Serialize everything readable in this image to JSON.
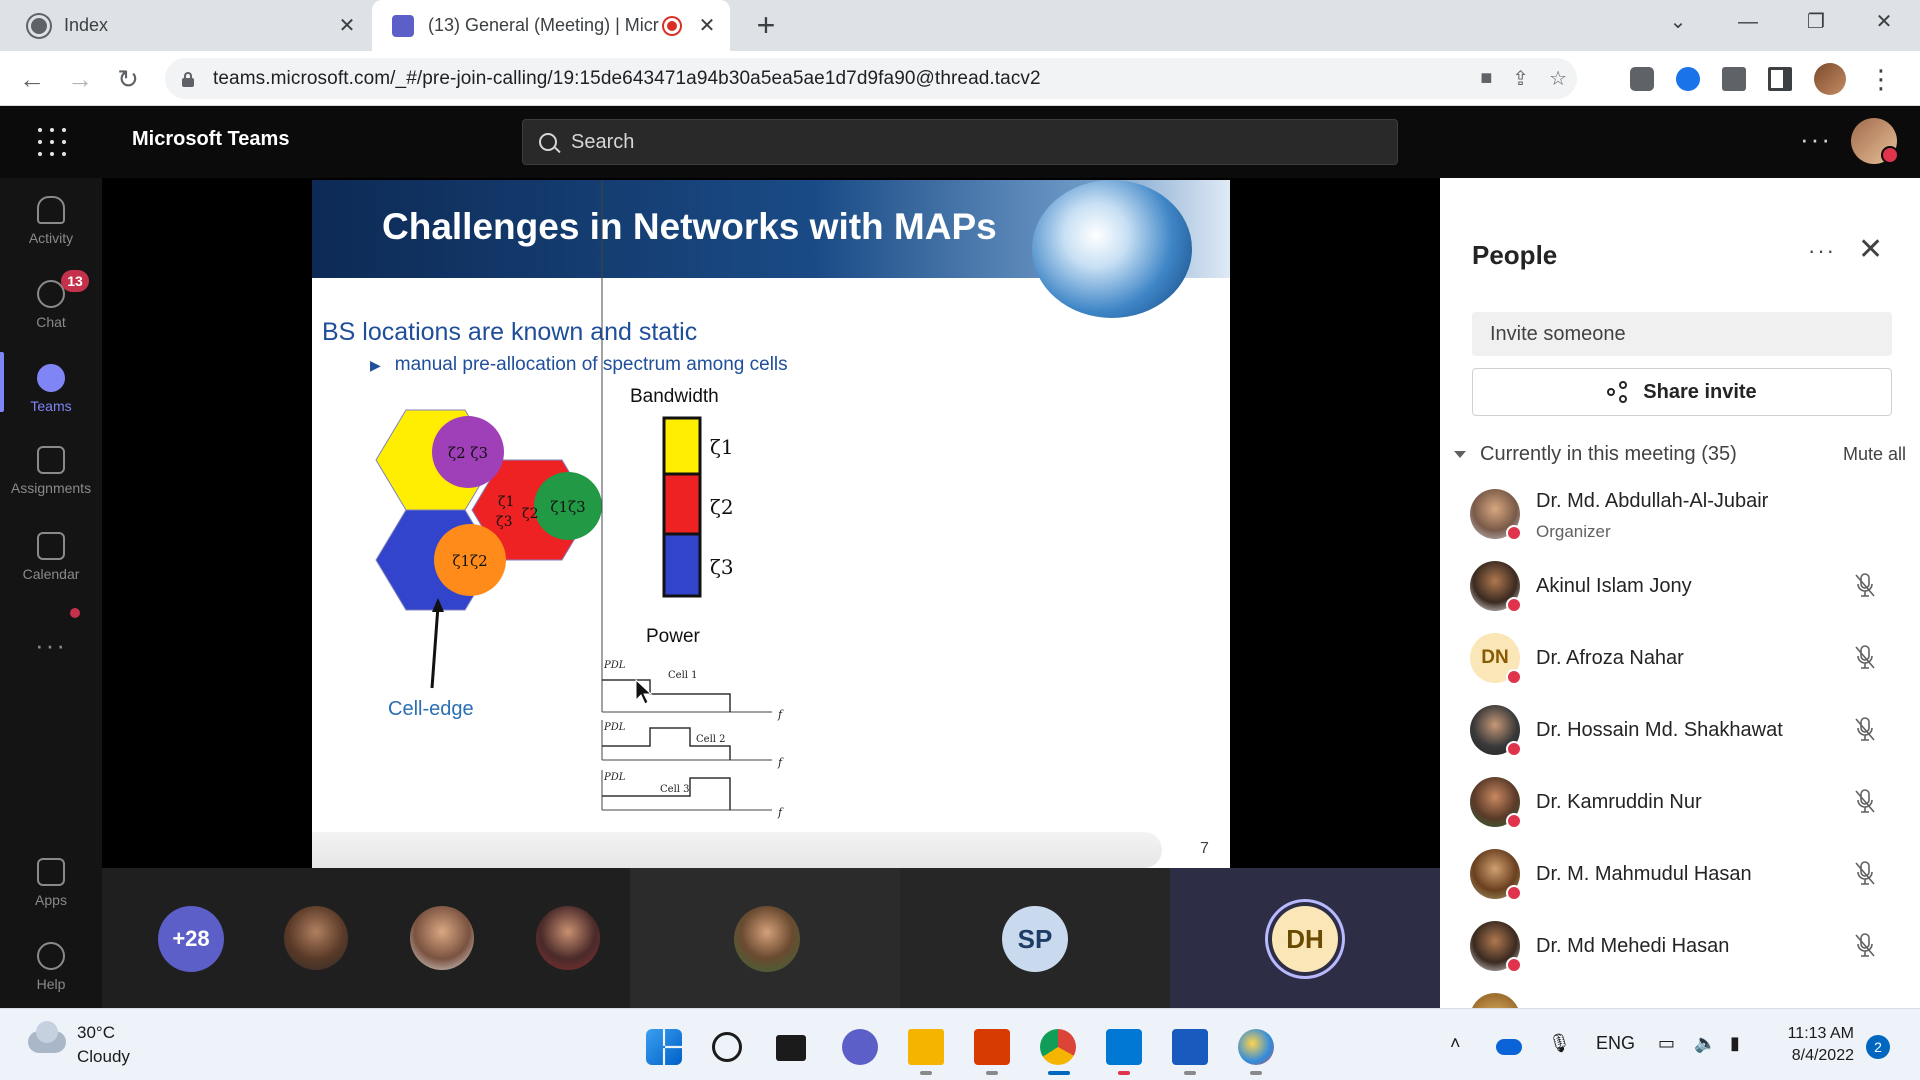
{
  "browser": {
    "tabs": [
      {
        "title": "Index"
      },
      {
        "title": "(13) General (Meeting) | Micr"
      }
    ],
    "url": "teams.microsoft.com/_#/pre-join-calling/19:15de643471a94b30a5ea5ae1d7d9fa90@thread.tacv2"
  },
  "teams": {
    "app_title": "Microsoft Teams",
    "search_placeholder": "Search"
  },
  "rail": {
    "items": [
      {
        "label": "Activity"
      },
      {
        "label": "Chat",
        "badge": "13"
      },
      {
        "label": "Teams"
      },
      {
        "label": "Assignments"
      },
      {
        "label": "Calendar"
      },
      {
        "label": "Apps"
      },
      {
        "label": "Help"
      }
    ]
  },
  "slide": {
    "title": "Challenges in Networks with MAPs",
    "heading": "BS locations are known and static",
    "bullet": "manual pre-allocation of spectrum among cells",
    "bandwidth_label": "Bandwidth",
    "power_label": "Power",
    "cell_edge_label": "Cell-edge",
    "legend": [
      "ζ1",
      "ζ2",
      "ζ3"
    ],
    "hex_labels": {
      "top": "ζ2 ζ3",
      "right": "ζ1ζ3",
      "bottom": "ζ1ζ2",
      "edge_a": "ζ1",
      "edge_b": "ζ3",
      "edge_c": "ζ2"
    },
    "power_plots": [
      {
        "axis": "PDL",
        "cell": "Cell 1",
        "f": "f"
      },
      {
        "axis": "PDL",
        "cell": "Cell 2",
        "f": "f"
      },
      {
        "axis": "PDL",
        "cell": "Cell 3",
        "f": "f"
      }
    ],
    "page_number": "7",
    "colors": {
      "yellow": "#ffee00",
      "red": "#ee2222",
      "blue": "#3344cc",
      "purple": "#a040b8",
      "green": "#229944",
      "orange": "#ff8c1a"
    }
  },
  "strip": {
    "overflow": "+28",
    "initials_sp": "SP",
    "initials_dh": "DH"
  },
  "people": {
    "title": "People",
    "invite_placeholder": "Invite someone",
    "share_invite": "Share invite",
    "section_label": "Currently in this meeting (35)",
    "mute_all": "Mute all",
    "participants": [
      {
        "name": "Dr. Md. Abdullah-Al-Jubair",
        "role": "Organizer"
      },
      {
        "name": "Akinul Islam Jony"
      },
      {
        "name": "Dr. Afroza Nahar",
        "initials": "DN"
      },
      {
        "name": "Dr. Hossain Md. Shakhawat"
      },
      {
        "name": "Dr. Kamruddin Nur"
      },
      {
        "name": "Dr. M. Mahmudul Hasan"
      },
      {
        "name": "Dr. Md Mehedi Hasan"
      }
    ]
  },
  "taskbar": {
    "temperature": "30°C",
    "condition": "Cloudy",
    "language": "ENG",
    "time": "11:13 AM",
    "date": "8/4/2022",
    "notifications": "2"
  }
}
